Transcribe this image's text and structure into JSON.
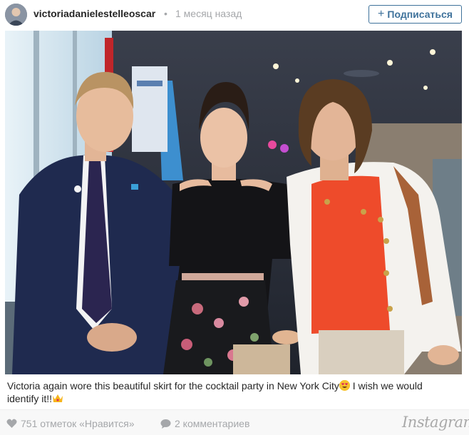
{
  "header": {
    "username": "victoriadanielestelleoscar",
    "separator": "•",
    "time_ago": "1 месяц назад",
    "follow_label": "Подписаться",
    "follow_icon": "plus-icon"
  },
  "caption": {
    "text_before_emoji": "Victoria again wore this beautiful skirt for the cocktail party in New York City",
    "emoji_1": "heart-eyes-emoji",
    "text_after_emoji": " I wish we would identify it!!",
    "emoji_2": "crown-emoji"
  },
  "footer": {
    "likes_icon": "heart-icon",
    "likes_text": "751 отметок «Нравится»",
    "comments_icon": "speech-bubble-icon",
    "comments_text": "2 комментариев",
    "brand": "Instagram"
  },
  "colors": {
    "accent": "#3f729b",
    "muted": "#a5a7aa",
    "text": "#262626"
  }
}
